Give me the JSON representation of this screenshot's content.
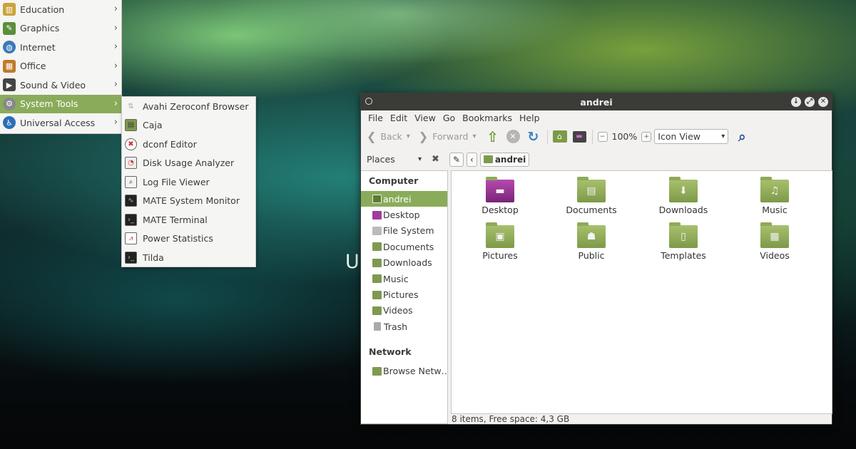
{
  "desktop": {
    "background_text": "U"
  },
  "app_menu": {
    "items": [
      {
        "label": "Education",
        "icon": "education-icon",
        "color": "#c9a33a"
      },
      {
        "label": "Graphics",
        "icon": "graphics-icon",
        "color": "#5a8f3c"
      },
      {
        "label": "Internet",
        "icon": "internet-icon",
        "color": "#3a78b8"
      },
      {
        "label": "Office",
        "icon": "office-icon",
        "color": "#c07a2a"
      },
      {
        "label": "Sound & Video",
        "icon": "sound-video-icon",
        "color": "#444444"
      },
      {
        "label": "System Tools",
        "icon": "system-tools-icon",
        "color": "#777777",
        "active": true
      },
      {
        "label": "Universal Access",
        "icon": "universal-access-icon",
        "color": "#2c6fb5"
      }
    ]
  },
  "submenu": {
    "items": [
      {
        "label": "Avahi Zeroconf Browser",
        "icon": "avahi-icon"
      },
      {
        "label": "Caja",
        "icon": "caja-icon"
      },
      {
        "label": "dconf Editor",
        "icon": "dconf-icon"
      },
      {
        "label": "Disk Usage Analyzer",
        "icon": "disk-usage-icon"
      },
      {
        "label": "Log File Viewer",
        "icon": "log-viewer-icon"
      },
      {
        "label": "MATE System Monitor",
        "icon": "system-monitor-icon"
      },
      {
        "label": "MATE Terminal",
        "icon": "terminal-icon"
      },
      {
        "label": "Power Statistics",
        "icon": "power-stats-icon"
      },
      {
        "label": "Tilda",
        "icon": "tilda-icon"
      }
    ]
  },
  "window": {
    "title": "andrei",
    "menubar": [
      "File",
      "Edit",
      "View",
      "Go",
      "Bookmarks",
      "Help"
    ],
    "toolbar": {
      "back": "Back",
      "forward": "Forward",
      "zoom": "100%",
      "view_mode": "Icon View"
    },
    "location": {
      "places": "Places",
      "path": "andrei"
    },
    "sidebar": {
      "computer_header": "Computer",
      "computer_items": [
        "andrei",
        "Desktop",
        "File System",
        "Documents",
        "Downloads",
        "Music",
        "Pictures",
        "Videos",
        "Trash"
      ],
      "network_header": "Network",
      "network_items": [
        "Browse Netw…"
      ]
    },
    "files": [
      {
        "name": "Desktop",
        "emblem": "▬"
      },
      {
        "name": "Documents",
        "emblem": "▤"
      },
      {
        "name": "Downloads",
        "emblem": "⬇"
      },
      {
        "name": "Music",
        "emblem": "♫"
      },
      {
        "name": "Pictures",
        "emblem": "▣"
      },
      {
        "name": "Public",
        "emblem": "☗"
      },
      {
        "name": "Templates",
        "emblem": "▯"
      },
      {
        "name": "Videos",
        "emblem": "▦"
      }
    ],
    "status": "8 items, Free space: 4,3 GB"
  },
  "colors": {
    "accent": "#8aac5a",
    "titlebar": "#3b3b37",
    "folder": "#7d9a48"
  }
}
